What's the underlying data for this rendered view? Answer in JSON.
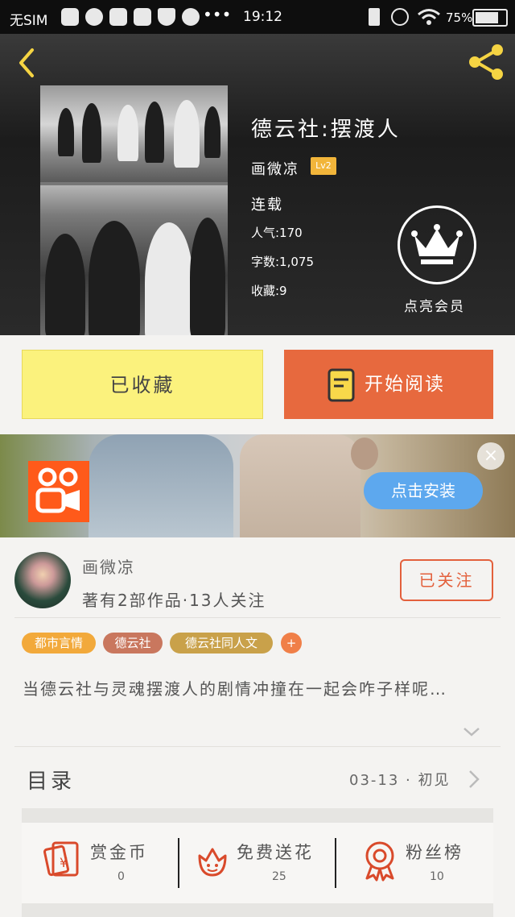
{
  "status_bar": {
    "carrier": "无SIM",
    "time": "19:12",
    "battery": "75%"
  },
  "book": {
    "title": "德云社:摆渡人",
    "author": "画微凉",
    "author_level": "Lv2",
    "status": "连载",
    "popularity": "人气:170",
    "word_count": "字数:1,075",
    "favorites": "收藏:9",
    "vip_label": "点亮会员"
  },
  "actions": {
    "collected_label": "已收藏",
    "read_label": "开始阅读"
  },
  "ad": {
    "install_label": "点击安装",
    "close_glyph": "×"
  },
  "author_info": {
    "name": "画微凉",
    "stats": "著有2部作品·13人关注",
    "follow_label": "已关注"
  },
  "tags": [
    {
      "label": "都市言情",
      "color": "#f2a93b"
    },
    {
      "label": "德云社",
      "color": "#c9775e"
    },
    {
      "label": "德云社同人文",
      "color": "#c9a14a"
    },
    {
      "label": "+",
      "color": "#f07f48"
    }
  ],
  "description": "当德云社与灵魂摆渡人的剧情冲撞在一起会咋子样呢…",
  "toc": {
    "label": "目录",
    "latest": "03-13 · 初见"
  },
  "stats": [
    {
      "label": "赏金币",
      "value": "0",
      "icon": "red-envelope-icon"
    },
    {
      "label": "免费送花",
      "value": "25",
      "icon": "flower-icon"
    },
    {
      "label": "粉丝榜",
      "value": "10",
      "icon": "ribbon-medal-icon"
    }
  ],
  "colors": {
    "accent_yellow": "#fbf27d",
    "accent_orange": "#e7693e",
    "icon_red": "#d94a2b"
  }
}
